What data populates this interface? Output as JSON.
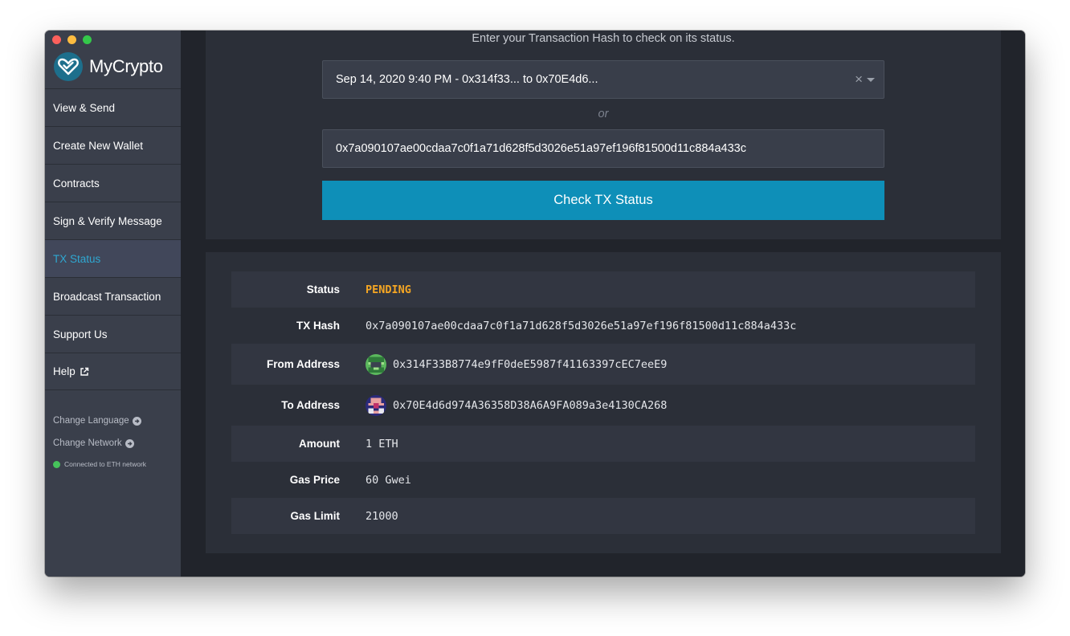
{
  "app": {
    "name": "MyCrypto"
  },
  "sidebar": {
    "items": [
      {
        "label": "View & Send"
      },
      {
        "label": "Create New Wallet"
      },
      {
        "label": "Contracts"
      },
      {
        "label": "Sign & Verify Message"
      },
      {
        "label": "TX Status",
        "active": true
      },
      {
        "label": "Broadcast Transaction"
      },
      {
        "label": "Support Us"
      },
      {
        "label": "Help",
        "icon": "external-link-icon"
      }
    ],
    "change_language": "Change Language",
    "change_network": "Change Network",
    "network_status": "Connected to ETH network"
  },
  "lookup": {
    "instruction": "Enter your Transaction Hash to check on its status.",
    "selected_tx": "Sep 14, 2020 9:40 PM - 0x314f33... to 0x70E4d6...",
    "or_label": "or",
    "hash_value": "0x7a090107ae00cdaa7c0f1a71d628f5d3026e51a97ef196f81500d11c884a433c",
    "check_button": "Check TX Status"
  },
  "details": {
    "status": {
      "label": "Status",
      "value": "PENDING"
    },
    "tx_hash": {
      "label": "TX Hash",
      "value": "0x7a090107ae00cdaa7c0f1a71d628f5d3026e51a97ef196f81500d11c884a433c"
    },
    "from": {
      "label": "From Address",
      "value": "0x314F33B8774e9fF0deE5987f41163397cEC7eeE9"
    },
    "to": {
      "label": "To Address",
      "value": "0x70E4d6d974A36358D38A6A9FA089a3e4130CA268"
    },
    "amount": {
      "label": "Amount",
      "value": "1 ETH"
    },
    "gas_price": {
      "label": "Gas Price",
      "value": "60 Gwei"
    },
    "gas_limit": {
      "label": "Gas Limit",
      "value": "21000"
    }
  },
  "colors": {
    "accent": "#0e8fb8",
    "active_nav": "#2fa7d1",
    "pending": "#f5a623",
    "connected": "#46c35b"
  }
}
